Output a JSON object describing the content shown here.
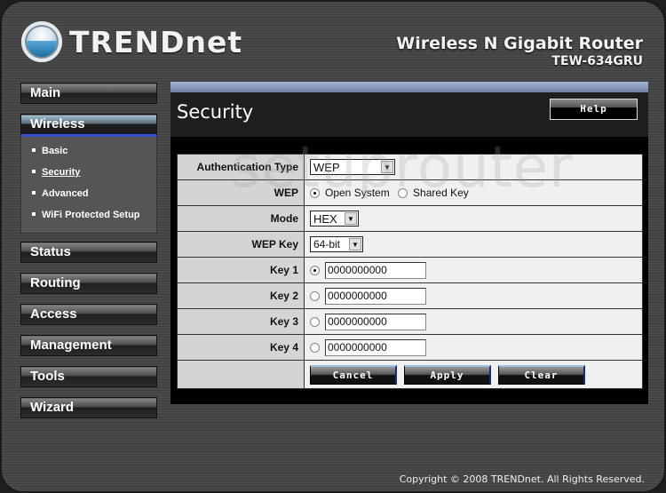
{
  "header": {
    "logo_text": "TRENDnet",
    "product_name": "Wireless N Gigabit Router",
    "model": "TEW-634GRU"
  },
  "nav": {
    "items": [
      {
        "label": "Main",
        "active": false
      },
      {
        "label": "Wireless",
        "active": true
      },
      {
        "label": "Status",
        "active": false
      },
      {
        "label": "Routing",
        "active": false
      },
      {
        "label": "Access",
        "active": false
      },
      {
        "label": "Management",
        "active": false
      },
      {
        "label": "Tools",
        "active": false
      },
      {
        "label": "Wizard",
        "active": false
      }
    ],
    "wireless_sub": [
      {
        "label": "Basic"
      },
      {
        "label": "Security",
        "current": true
      },
      {
        "label": "Advanced"
      },
      {
        "label": "WiFi Protected Setup"
      }
    ]
  },
  "panel": {
    "title": "Security",
    "help_label": "Help"
  },
  "form": {
    "auth_type": {
      "label": "Authentication Type",
      "value": "WEP"
    },
    "wep": {
      "label": "WEP",
      "options": [
        "Open System",
        "Shared Key"
      ],
      "selected": "Open System"
    },
    "mode": {
      "label": "Mode",
      "value": "HEX"
    },
    "wep_key": {
      "label": "WEP Key",
      "value": "64-bit"
    },
    "keys": [
      {
        "label": "Key 1",
        "value": "0000000000",
        "selected": true
      },
      {
        "label": "Key 2",
        "value": "0000000000",
        "selected": false
      },
      {
        "label": "Key 3",
        "value": "0000000000",
        "selected": false
      },
      {
        "label": "Key 4",
        "value": "0000000000",
        "selected": false
      }
    ],
    "buttons": {
      "cancel": "Cancel",
      "apply": "Apply",
      "clear": "Clear"
    }
  },
  "watermark": "setuprouter",
  "footer": {
    "copyright": "Copyright © 2008 TRENDnet. All Rights Reserved."
  }
}
